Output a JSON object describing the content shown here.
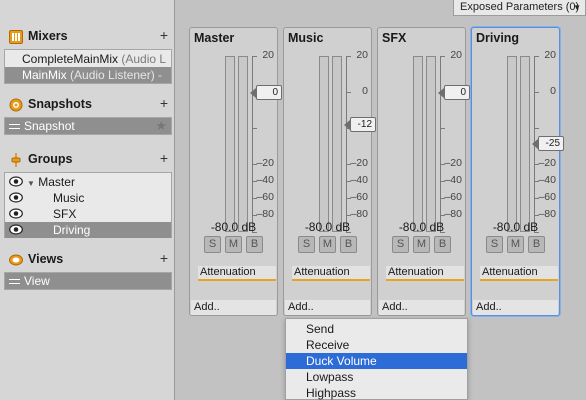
{
  "exposed_parameters": {
    "label": "Exposed Parameters (0)"
  },
  "mixers": {
    "title": "Mixers",
    "add": "+",
    "items": [
      {
        "name": "CompleteMainMix",
        "sub": "(Audio L"
      },
      {
        "name": "MainMix",
        "sub": "(Audio Listener) -"
      }
    ]
  },
  "snapshots": {
    "title": "Snapshots",
    "add": "+",
    "items": [
      {
        "name": "Snapshot",
        "star": "★"
      }
    ]
  },
  "groups": {
    "title": "Groups",
    "add": "+",
    "items": [
      {
        "name": "Master",
        "expander": "▼"
      },
      {
        "name": "Music"
      },
      {
        "name": "SFX"
      },
      {
        "name": "Driving"
      }
    ]
  },
  "views": {
    "title": "Views",
    "add": "+",
    "items": [
      {
        "name": "View"
      }
    ]
  },
  "scale_labels": [
    "20",
    "0",
    "–20",
    "–40",
    "–60",
    "–80"
  ],
  "strips": [
    {
      "name": "Master",
      "fader": "0",
      "db": "-80.0 dB",
      "solo": "S",
      "mute": "M",
      "bypass": "B",
      "effect": "Attenuation",
      "add": "Add.."
    },
    {
      "name": "Music",
      "fader": "-12",
      "db": "-80.0 dB",
      "solo": "S",
      "mute": "M",
      "bypass": "B",
      "effect": "Attenuation",
      "add": "Add.."
    },
    {
      "name": "SFX",
      "fader": "0",
      "db": "-80.0 dB",
      "solo": "S",
      "mute": "M",
      "bypass": "B",
      "effect": "Attenuation",
      "add": "Add.."
    },
    {
      "name": "Driving",
      "fader": "-25",
      "db": "-80.0 dB",
      "solo": "S",
      "mute": "M",
      "bypass": "B",
      "effect": "Attenuation",
      "add": "Add.."
    }
  ],
  "menu": {
    "items": [
      "Send",
      "Receive",
      "Duck Volume",
      "Lowpass",
      "Highpass"
    ],
    "highlighted": "Duck Volume"
  },
  "colors": {
    "selection_gray": "#8f8f8f",
    "active_strip_border": "#5b8fd8",
    "effect_underline": "#e8a323",
    "menu_highlight": "#2d6bd6",
    "section_icon_orange": "#e89a1c"
  }
}
